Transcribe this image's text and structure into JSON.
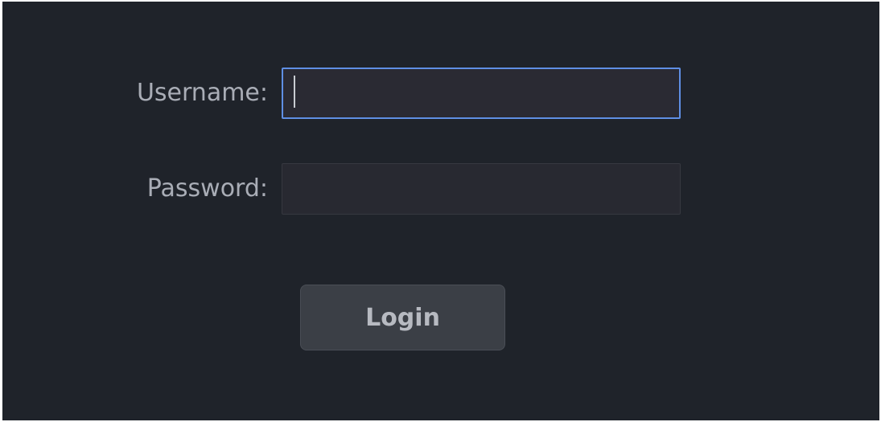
{
  "form": {
    "username": {
      "label": "Username:",
      "value": "",
      "placeholder": ""
    },
    "password": {
      "label": "Password:",
      "value": "",
      "placeholder": ""
    },
    "login_button": {
      "label": "Login"
    }
  },
  "colors": {
    "background": "#1f232a",
    "field_background": "#282931",
    "focus_border": "#5f8fe4",
    "label_text": "#a9adb6",
    "button_background": "#3b3f46",
    "button_text": "#b7bac1"
  }
}
